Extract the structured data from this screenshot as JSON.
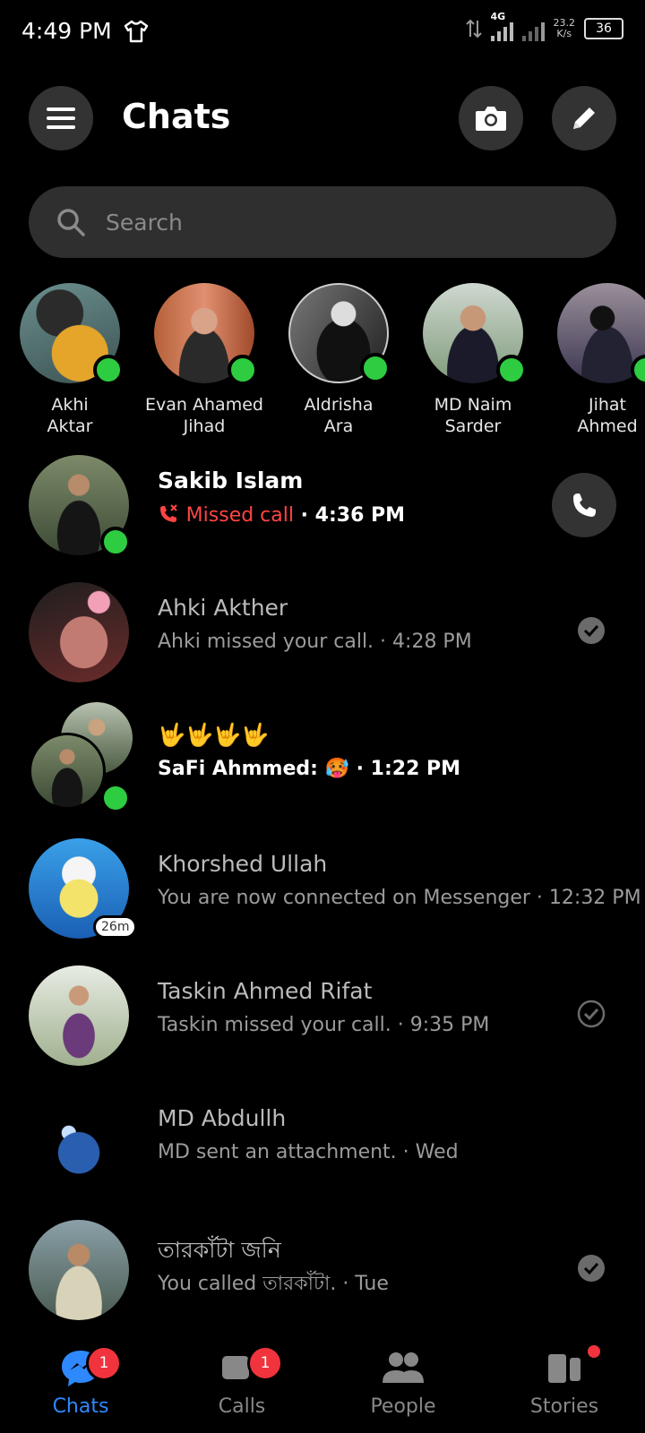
{
  "status_bar": {
    "time": "4:49 PM",
    "network": "4G",
    "speed_value": "23.2",
    "speed_unit": "K/s",
    "battery": "36"
  },
  "header": {
    "title": "Chats",
    "menu_icon": "hamburger-icon",
    "camera_icon": "camera-icon",
    "compose_icon": "pencil-icon"
  },
  "search": {
    "placeholder": "Search"
  },
  "active_contacts": [
    {
      "first": "Akhi",
      "second": "Aktar",
      "online": true
    },
    {
      "first": "Evan Ahamed",
      "second": "Jihad",
      "online": true
    },
    {
      "first": "Aldrisha",
      "second": "Ara",
      "online": true
    },
    {
      "first": "MD Naim",
      "second": "Sarder",
      "online": true
    },
    {
      "first": "Jihat",
      "second": "Ahmed",
      "online": true
    }
  ],
  "chats": [
    {
      "name": "Sakib Islam",
      "missed_label": "Missed call",
      "time": "· 4:36 PM",
      "unread": true,
      "online": true
    },
    {
      "name": "Ahki Akther",
      "preview": "Ahki missed your call. · 4:28 PM",
      "unread": false
    },
    {
      "name": "🤟🤟🤟🤟",
      "preview": "SaFi Ahmmed: 🥵 · 1:22 PM",
      "unread": true,
      "online": true
    },
    {
      "name": "Khorshed Ullah",
      "preview": "You are now connected on Messenger · 12:32 PM",
      "badge": "26m",
      "unread": false
    },
    {
      "name": "Taskin Ahmed Rifat",
      "preview": "Taskin missed your call. · 9:35 PM",
      "unread": false
    },
    {
      "name": "MD Abdullh",
      "preview": "MD sent an attachment. · Wed",
      "unread": false
    },
    {
      "name": "তারকাঁটা জনি",
      "preview": "You called তারকাঁটা. · Tue",
      "unread": false
    }
  ],
  "bottom_nav": [
    {
      "label": "Chats",
      "badge": "1",
      "active": true
    },
    {
      "label": "Calls",
      "badge": "1",
      "active": false
    },
    {
      "label": "People",
      "active": false
    },
    {
      "label": "Stories",
      "active": false
    }
  ],
  "colors": {
    "accent": "#2e89ff",
    "online": "#2ecc40",
    "missed": "#ff4444",
    "badge": "#f0333c"
  }
}
